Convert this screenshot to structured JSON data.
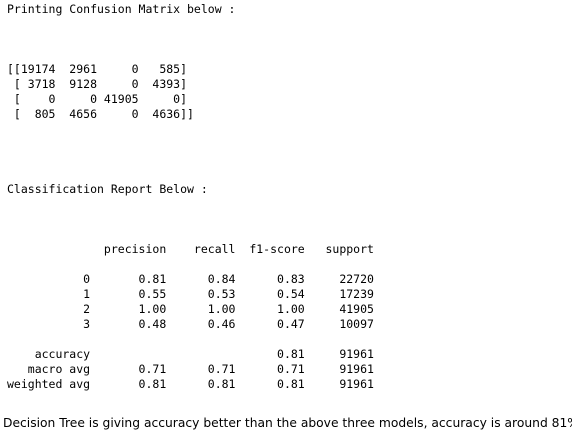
{
  "output": {
    "confusion_heading": "Printing Confusion Matrix below :",
    "matrix_lines": [
      "[[19174  2961     0   585]",
      " [ 3718  9128     0  4393]",
      " [    0     0 41905     0]",
      " [  805  4656     0  4636]]"
    ],
    "report_heading": "Classification Report Below :",
    "report_header": "              precision    recall  f1-score   support",
    "report_rows": [
      "           0       0.81      0.84      0.83     22720",
      "           1       0.55      0.53      0.54     17239",
      "           2       1.00      1.00      1.00     41905",
      "           3       0.48      0.46      0.47     10097"
    ],
    "report_summary": [
      "    accuracy                           0.81     91961",
      "   macro avg       0.71      0.71      0.71     91961",
      "weighted avg       0.81      0.81      0.81     91961"
    ]
  },
  "note": {
    "text": "Decision Tree is giving accuracy better than the above three models, accuracy is around 81%"
  }
}
